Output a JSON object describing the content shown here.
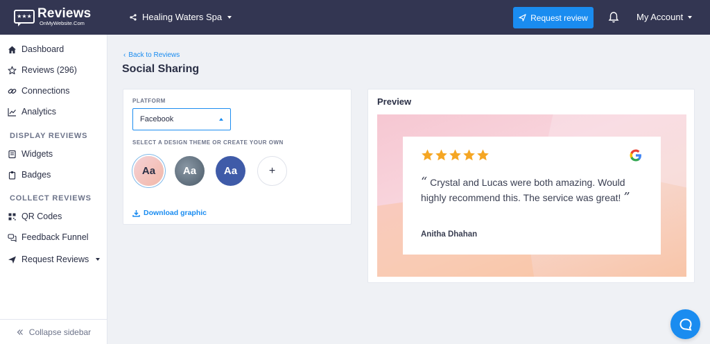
{
  "logo": {
    "title": "Reviews",
    "subtitle": "OnMyWebsite.Com",
    "badge_stars": "★★★"
  },
  "header": {
    "business_name": "Healing Waters Spa",
    "request_review_label": "Request review",
    "account_label": "My Account"
  },
  "sidebar": {
    "items": [
      {
        "label": "Dashboard",
        "icon": "home-icon"
      },
      {
        "label": "Reviews (296)",
        "icon": "star-outline-icon"
      },
      {
        "label": "Connections",
        "icon": "link-icon"
      },
      {
        "label": "Analytics",
        "icon": "chart-icon"
      }
    ],
    "section_display": "DISPLAY REVIEWS",
    "display_items": [
      {
        "label": "Widgets",
        "icon": "widget-icon"
      },
      {
        "label": "Badges",
        "icon": "badge-icon"
      }
    ],
    "section_collect": "COLLECT REVIEWS",
    "collect_items": [
      {
        "label": "QR Codes",
        "icon": "qr-icon"
      },
      {
        "label": "Feedback Funnel",
        "icon": "chat-bubbles-icon"
      },
      {
        "label": "Request Reviews",
        "icon": "send-icon"
      }
    ],
    "collapse_label": "Collapse sidebar"
  },
  "main": {
    "back_label": "Back to Reviews",
    "title": "Social Sharing",
    "platform_label": "PLATFORM",
    "platform_value": "Facebook",
    "theme_label": "SELECT A DESIGN THEME OR CREATE YOUR OWN",
    "themes": [
      {
        "label": "Aa",
        "name": "pink"
      },
      {
        "label": "Aa",
        "name": "slate"
      },
      {
        "label": "Aa",
        "name": "blue"
      },
      {
        "label": "+",
        "name": "custom"
      }
    ],
    "download_label": "Download graphic"
  },
  "preview": {
    "title": "Preview",
    "rating": 5,
    "open_quote": "“",
    "close_quote": "”",
    "quote": "Crystal and Lucas were both amazing. Would highly recommend this. The service was great!",
    "author": "Anitha Dhahan",
    "source": "google-icon"
  },
  "colors": {
    "topbar": "#333652",
    "accent": "#1a8cf0",
    "star": "#f5a623"
  }
}
